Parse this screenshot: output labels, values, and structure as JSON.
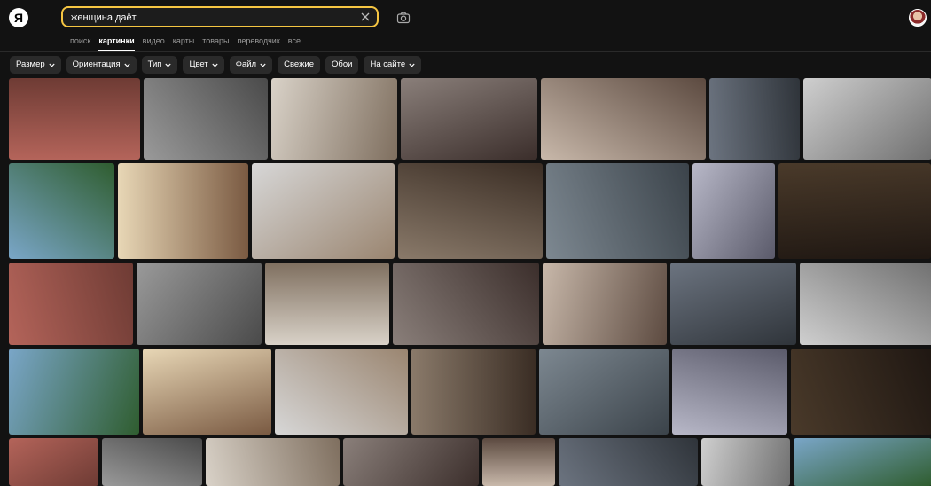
{
  "colors": {
    "accent": "#f5c542",
    "background": "#121212",
    "chip": "#2a2a2a"
  },
  "header": {
    "logo": "Я",
    "search": {
      "value": "женщина даёт",
      "clear_icon": "close-icon",
      "camera_icon": "camera-icon"
    },
    "avatar": "user-avatar"
  },
  "tabs": [
    {
      "label": "поиск"
    },
    {
      "label": "картинки",
      "active": true
    },
    {
      "label": "видео"
    },
    {
      "label": "карты"
    },
    {
      "label": "товары"
    },
    {
      "label": "переводчик"
    },
    {
      "label": "все"
    }
  ],
  "filters": [
    {
      "label": "Размер",
      "dropdown": true
    },
    {
      "label": "Ориентация",
      "dropdown": true
    },
    {
      "label": "Тип",
      "dropdown": true
    },
    {
      "label": "Цвет",
      "dropdown": true
    },
    {
      "label": "Файл",
      "dropdown": true
    },
    {
      "label": "Свежие",
      "dropdown": false
    },
    {
      "label": "Обои",
      "dropdown": false
    },
    {
      "label": "На сайте",
      "dropdown": true
    }
  ],
  "results": {
    "rows": 5,
    "thumbnails": 37
  }
}
